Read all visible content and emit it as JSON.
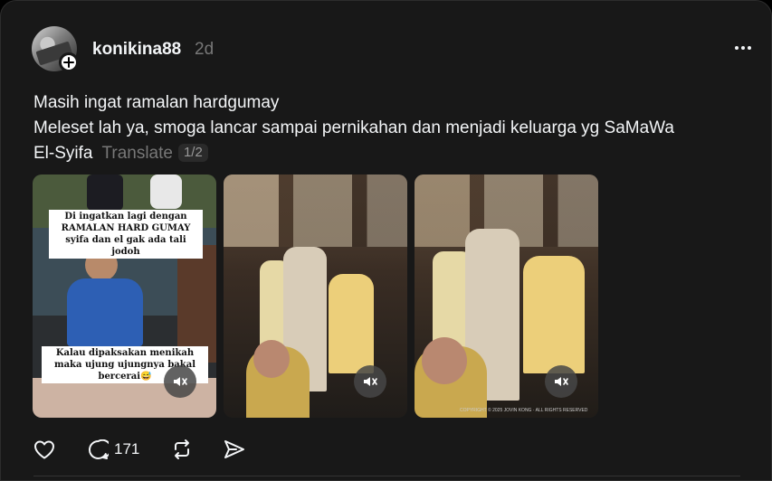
{
  "post": {
    "username": "konikina88",
    "time": "2d",
    "caption_lines": [
      "Masih ingat ramalan hardgumay",
      "Meleset lah ya, smoga lancar sampai pernikahan dan menjadi keluarga yg SaMaWa",
      "El-Syifa"
    ],
    "translate_label": "Translate",
    "page_indicator": "1/2"
  },
  "media": [
    {
      "overlay_top": "Di ingatkan lagi dengan RAMALAN HARD GUMAY syifa dan el gak ada tali jodoh",
      "overlay_bottom": "Kalau dipaksakan menikah maka ujung ujungnya bakal bercerai😅",
      "mute_icon": "speaker-muted-icon"
    },
    {
      "mute_icon": "speaker-muted-icon"
    },
    {
      "watermark": "COPYRIGHT © 2025 JOVIN KONG · ALL RIGHTS RESERVED",
      "mute_icon": "speaker-muted-icon"
    }
  ],
  "actions": {
    "like_icon": "heart-icon",
    "comment_icon": "comment-icon",
    "comment_count": "171",
    "repost_icon": "repost-icon",
    "share_icon": "share-icon"
  },
  "colors": {
    "background": "#181818",
    "primary_text": "#f3f5f7",
    "secondary_text": "#777777"
  }
}
